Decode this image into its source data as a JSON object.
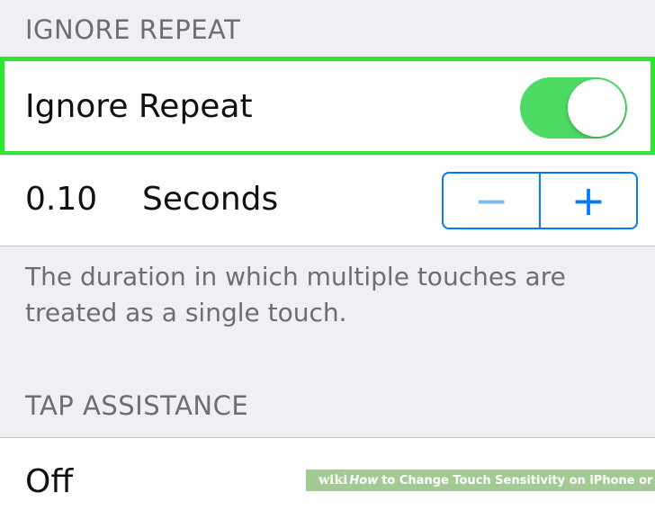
{
  "sections": {
    "ignore_repeat_header": "IGNORE REPEAT",
    "tap_assistance_header": "TAP ASSISTANCE"
  },
  "ignore_repeat": {
    "label": "Ignore Repeat",
    "toggle_on": true
  },
  "duration": {
    "value": "0.10",
    "unit": "Seconds",
    "decrement_label": "−",
    "increment_label": "+"
  },
  "footer": {
    "description": "The duration in which multiple touches are treated as a single touch."
  },
  "tap_assistance": {
    "value": "Off"
  },
  "watermark": {
    "brand": "wiki",
    "how": "How",
    "title": "to Change Touch Sensitivity on iPhone or iPad"
  },
  "colors": {
    "highlight": "#2ee62e",
    "toggle_on": "#4cd964",
    "accent": "#007aff"
  }
}
